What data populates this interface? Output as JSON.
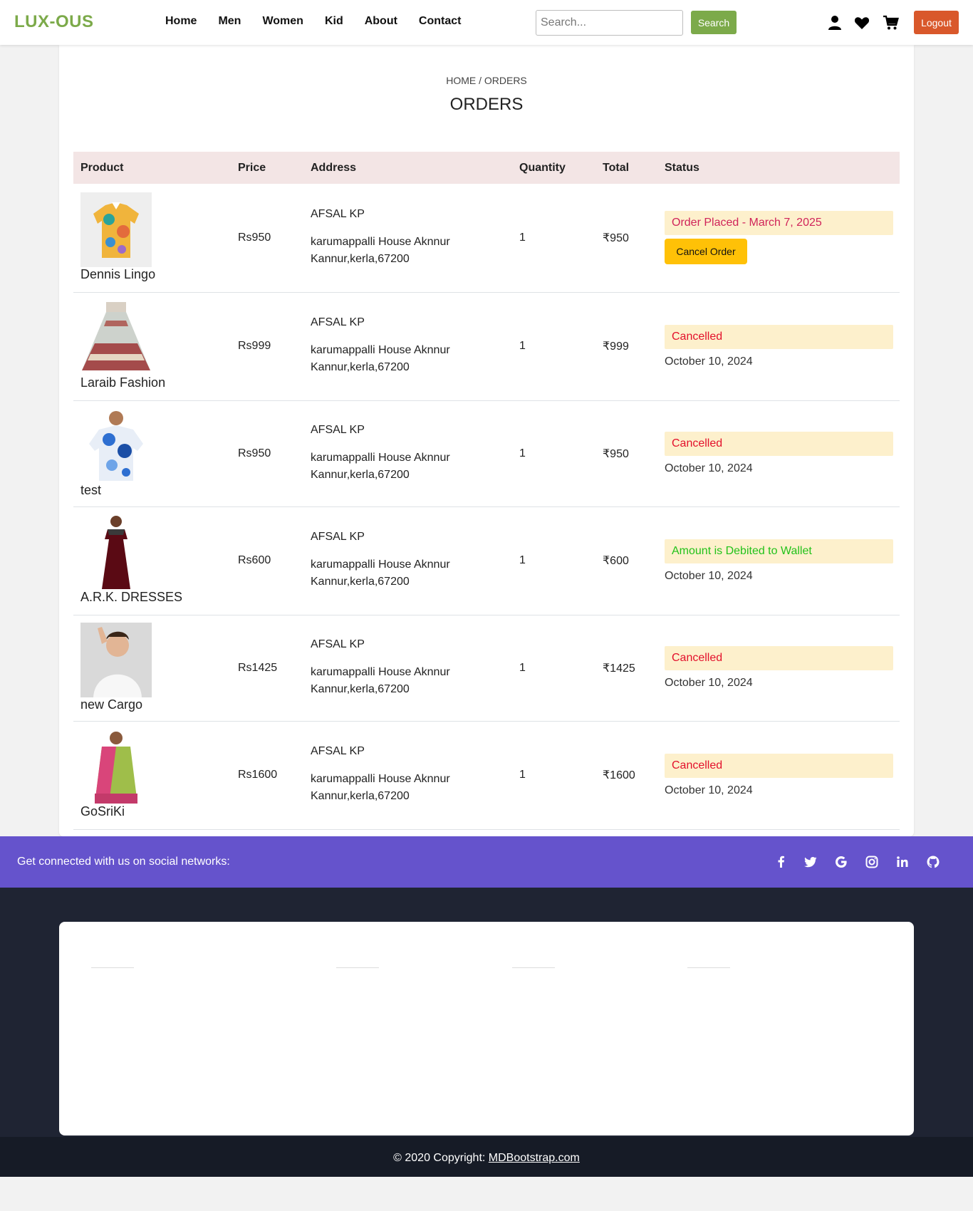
{
  "navbar": {
    "brand": "LUX-OUS",
    "links": [
      "Home",
      "Men",
      "Women",
      "Kid",
      "About",
      "Contact"
    ],
    "search_placeholder": "Search...",
    "search_label": "Search",
    "logout_label": "Logout",
    "icons": [
      "user-icon",
      "heart-icon",
      "cart-icon"
    ]
  },
  "page": {
    "breadcrumb": "HOME / ORDERS",
    "title": "ORDERS"
  },
  "table": {
    "headers": [
      "Product",
      "Price",
      "Address",
      "Quantity",
      "Total",
      "Status"
    ],
    "cancel_label": "Cancel Order",
    "rows": [
      {
        "product": "Dennis Lingo",
        "price": "Rs950",
        "address_name": "AFSAL KP",
        "address_line1": "karumappalli House Aknnur",
        "address_line2": "Kannur,kerla,67200",
        "quantity": "1",
        "total": "₹950",
        "status": "Order Placed - March 7, 2025",
        "date": ""
      },
      {
        "product": "Laraib Fashion",
        "price": "Rs999",
        "address_name": "AFSAL KP",
        "address_line1": "karumappalli House Aknnur",
        "address_line2": "Kannur,kerla,67200",
        "quantity": "1",
        "total": "₹999",
        "status": "Cancelled",
        "date": "October 10, 2024"
      },
      {
        "product": "test",
        "price": "Rs950",
        "address_name": "AFSAL KP",
        "address_line1": "karumappalli House Aknnur",
        "address_line2": "Kannur,kerla,67200",
        "quantity": "1",
        "total": "₹950",
        "status": "Cancelled",
        "date": "October 10, 2024"
      },
      {
        "product": "A.R.K. DRESSES",
        "price": "Rs600",
        "address_name": "AFSAL KP",
        "address_line1": "karumappalli House Aknnur",
        "address_line2": "Kannur,kerla,67200",
        "quantity": "1",
        "total": "₹600",
        "status": "Amount is Debited to Wallet",
        "date": "October 10, 2024"
      },
      {
        "product": "new Cargo",
        "price": "Rs1425",
        "address_name": "AFSAL KP",
        "address_line1": "karumappalli House Aknnur",
        "address_line2": "Kannur,kerla,67200",
        "quantity": "1",
        "total": "₹1425",
        "status": "Cancelled",
        "date": "October 10, 2024"
      },
      {
        "product": "GoSriKi",
        "price": "Rs1600",
        "address_name": "AFSAL KP",
        "address_line1": "karumappalli House Aknnur",
        "address_line2": "Kannur,kerla,67200",
        "quantity": "1",
        "total": "₹1600",
        "status": "Cancelled",
        "date": "October 10, 2024"
      }
    ]
  },
  "social": {
    "text": "Get connected with us on social networks:",
    "icons": [
      "facebook-icon",
      "twitter-icon",
      "google-icon",
      "instagram-icon",
      "linkedin-icon",
      "github-icon"
    ]
  },
  "footer": {
    "copyright": "© 2020 Copyright:",
    "link": "MDBootstrap.com"
  },
  "colors": {
    "brand": "#7caa4a",
    "logout": "#d9582b",
    "header_bg": "#f3e5e5",
    "status_bg": "#fdf0cc",
    "cancelled": "#e3102b",
    "wallet": "#22c21a",
    "cancel_button": "#ffc107",
    "social_bar": "#6553cc",
    "footer_bg": "#1f2433"
  }
}
